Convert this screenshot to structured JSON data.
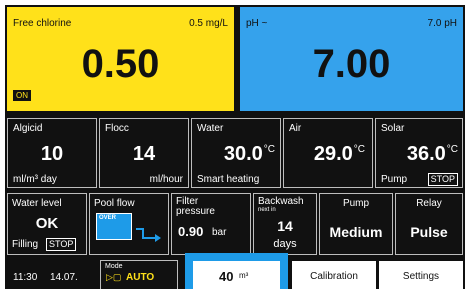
{
  "chlorine": {
    "label": "Free chlorine",
    "setpoint": "0.5 mg/L",
    "value": "0.50",
    "status": "ON"
  },
  "ph": {
    "label": "pH ~",
    "setpoint": "7.0  pH",
    "value": "7.00"
  },
  "row1": {
    "algicid": {
      "label": "Algicid",
      "value": "10",
      "unit": "ml/m³ day"
    },
    "flocc": {
      "label": "Flocc",
      "value": "14",
      "unit": "ml/hour"
    },
    "water": {
      "label": "Water",
      "value": "30.0",
      "deg": "°C",
      "sub": "Smart heating"
    },
    "air": {
      "label": "Air",
      "value": "29.0",
      "deg": "°C"
    },
    "solar": {
      "label": "Solar",
      "value": "36.0",
      "deg": "°C",
      "sub": "Pump",
      "btn": "STOP"
    }
  },
  "row2": {
    "water_level": {
      "label": "Water level",
      "value": "OK",
      "sub": "Filling",
      "btn": "STOP"
    },
    "pool_flow": {
      "label": "Pool flow",
      "tag": "OVER"
    },
    "filter": {
      "label1": "Filter",
      "label2": "pressure",
      "value": "0.90",
      "unit": "bar"
    },
    "backwash": {
      "label": "Backwash",
      "small": "next in",
      "value": "14",
      "unit": "days"
    },
    "pump": {
      "label": "Pump",
      "value": "Medium"
    },
    "relay": {
      "label": "Relay",
      "value": "Pulse"
    }
  },
  "bottom": {
    "time": "11:30",
    "date": "14.07.",
    "mode_label": "Mode",
    "mode_value": "AUTO",
    "volume": "40",
    "volume_unit": "m³",
    "calibration": "Calibration",
    "settings": "Settings"
  },
  "colors": {
    "chlorine": "#ffe11a",
    "ph": "#35a2ec",
    "highlight": "#1e9be8",
    "background": "#101010"
  }
}
